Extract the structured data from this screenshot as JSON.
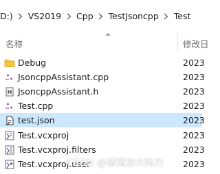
{
  "breadcrumb": {
    "items": [
      "D:)",
      "VS2019",
      "Cpp",
      "TestJsoncpp",
      "Test"
    ]
  },
  "columns": {
    "name": "名称",
    "date": "修改日"
  },
  "files": [
    {
      "name": "Debug",
      "date": "2023",
      "icon": "folder-icon",
      "selected": false
    },
    {
      "name": "JsoncppAssistant.cpp",
      "date": "2023",
      "icon": "cpp-file-icon",
      "selected": false
    },
    {
      "name": "JsoncppAssistant.h",
      "date": "2023",
      "icon": "header-file-icon",
      "selected": false
    },
    {
      "name": "Test.cpp",
      "date": "2023",
      "icon": "cpp-file-icon",
      "selected": false
    },
    {
      "name": "test.json",
      "date": "2023",
      "icon": "json-file-icon",
      "selected": true
    },
    {
      "name": "Test.vcxproj",
      "date": "2023",
      "icon": "vcxproj-file-icon",
      "selected": false
    },
    {
      "name": "Test.vcxproj.filters",
      "date": "2023",
      "icon": "filters-file-icon",
      "selected": false
    },
    {
      "name": "Test.vcxproj.user",
      "date": "2023",
      "icon": "user-file-icon",
      "selected": false
    }
  ],
  "watermark": "CSDN @猪猪加大码力",
  "colors": {
    "selection": "#cce8ff",
    "folder": "#f4c542",
    "cpp_accent": "#8a4fa8"
  }
}
